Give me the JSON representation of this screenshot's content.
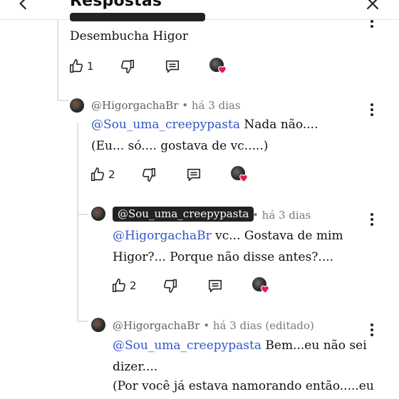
{
  "header": {
    "title": "Respostas"
  },
  "comments": [
    {
      "body_lines": [
        "Desembucha Higor"
      ],
      "likes": "1"
    },
    {
      "handle": "@HigorgachaBr",
      "meta": " • há 3 dias",
      "mention": "@Sou_uma_creepypasta",
      "body_first": " Nada não....",
      "body_lines": [
        "(Eu... só.... gostava de vc.....)"
      ],
      "likes": "2"
    },
    {
      "handle": "@Sou_uma_creepypasta",
      "meta": "• há 3 dias",
      "mention": "@HigorgachaBr",
      "body_first": " vc... Gostava de mim",
      "body_lines": [
        "Higor?... Porque não disse antes?...."
      ],
      "likes": "2"
    },
    {
      "handle": "@HigorgachaBr",
      "meta": " • há 3 dias (editado)",
      "mention": "@Sou_uma_creepypasta",
      "body_first": " Bem...eu não sei",
      "body_lines": [
        "dizer....",
        "(Por você já estava namorando então.....eu"
      ]
    }
  ],
  "icons": {
    "back": "arrow-left-icon",
    "close": "close-icon",
    "like": "thumbs-up-icon",
    "dislike": "thumbs-down-icon",
    "reply": "reply-comment-icon",
    "more": "more-vertical-icon",
    "creator_heart": "creator-heart-icon"
  },
  "colors": {
    "mention": "#3056c7",
    "heart": "#e8194b",
    "chip_bg": "#222222"
  }
}
